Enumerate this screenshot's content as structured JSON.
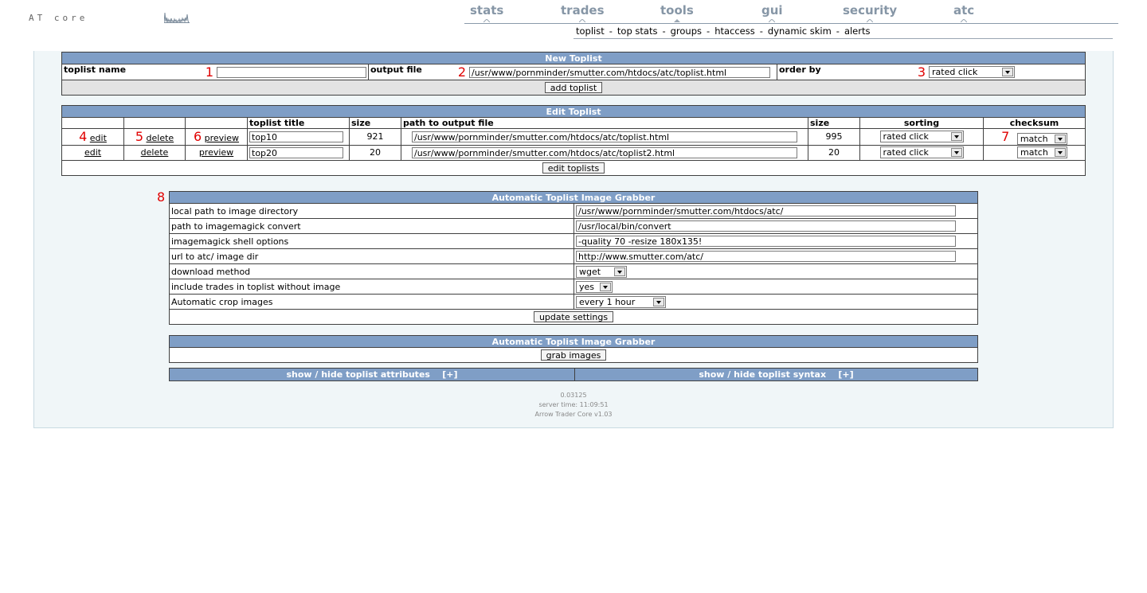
{
  "logo": "AT core",
  "nav": {
    "items": [
      {
        "label": "stats"
      },
      {
        "label": "trades"
      },
      {
        "label": "tools"
      },
      {
        "label": "gui"
      },
      {
        "label": "security"
      },
      {
        "label": "atc"
      }
    ]
  },
  "subnav": {
    "items": [
      "toplist",
      "top stats",
      "groups",
      "htaccess",
      "dynamic skim",
      "alerts"
    ],
    "separator": "-"
  },
  "new_toplist": {
    "header": "New Toplist",
    "name_label": "toplist name",
    "name_marker": "1",
    "name_value": "",
    "output_label": "output file",
    "output_marker": "2",
    "output_value": "/usr/www/pornminder/smutter.com/htdocs/atc/toplist.html",
    "order_label": "order by",
    "order_marker": "3",
    "order_value": "rated click",
    "add_button": "add toplist"
  },
  "edit_toplist": {
    "header": "Edit Toplist",
    "columns": {
      "title": "toplist title",
      "size": "size",
      "path": "path to output file",
      "size2": "size",
      "sorting": "sorting",
      "checksum": "checksum"
    },
    "markers": {
      "edit": "4",
      "delete": "5",
      "preview": "6",
      "checksum": "7"
    },
    "rows": [
      {
        "edit": "edit",
        "delete": "delete",
        "preview": "preview",
        "title": "top10",
        "size": "921",
        "path": "/usr/www/pornminder/smutter.com/htdocs/atc/toplist.html",
        "size2": "995",
        "sorting": "rated click",
        "checksum": "match"
      },
      {
        "edit": "edit",
        "delete": "delete",
        "preview": "preview",
        "title": "top20",
        "size": "20",
        "path": "/usr/www/pornminder/smutter.com/htdocs/atc/toplist2.html",
        "size2": "20",
        "sorting": "rated click",
        "checksum": "match"
      }
    ],
    "edit_button": "edit toplists"
  },
  "grabber": {
    "marker": "8",
    "header": "Automatic Toplist Image Grabber",
    "rows": [
      {
        "label": "local path to image directory",
        "value": "/usr/www/pornminder/smutter.com/htdocs/atc/"
      },
      {
        "label": "path to imagemagick convert",
        "value": "/usr/local/bin/convert"
      },
      {
        "label": "imagemagick shell options",
        "value": "-quality 70 -resize 180x135!"
      },
      {
        "label": "url to atc/ image dir",
        "value": "http://www.smutter.com/atc/"
      }
    ],
    "download_label": "download method",
    "download_value": "wget",
    "include_label": "include trades in toplist without image",
    "include_value": "yes",
    "crop_label": "Automatic crop images",
    "crop_value": "every 1 hour",
    "update_button": "update settings"
  },
  "grabber2": {
    "header": "Automatic Toplist Image Grabber",
    "grab_button": "grab images"
  },
  "toggles": {
    "attributes": "show / hide toplist attributes",
    "attributes_toggle": "[+]",
    "syntax": "show / hide toplist syntax",
    "syntax_toggle": "[+]"
  },
  "footer": {
    "time": "0.03125",
    "server_time": "server time: 11:09:51",
    "version": "Arrow Trader Core v1.03"
  },
  "colors": {
    "header_bg": "#7f9ec6",
    "nav_text": "#8696a6",
    "marker": "#e00000",
    "panel_bg": "#f0f6f8"
  }
}
